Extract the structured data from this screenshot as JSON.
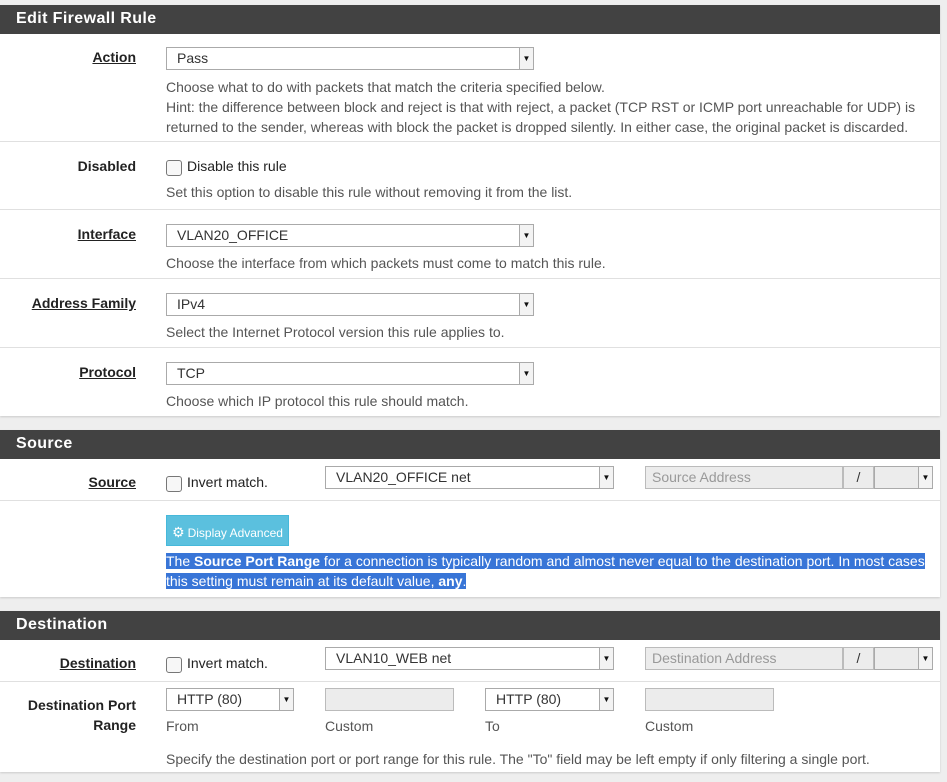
{
  "rule_panel": {
    "title": "Edit Firewall Rule",
    "action": {
      "label": "Action",
      "value": "Pass",
      "help_line1": "Choose what to do with packets that match the criteria specified below.",
      "help_line2": "Hint: the difference between block and reject is that with reject, a packet (TCP RST or ICMP port unreachable for UDP) is",
      "help_line3": "returned to the sender, whereas with block the packet is dropped silently. In either case, the original packet is discarded."
    },
    "disabled": {
      "label": "Disabled",
      "checkbox_text": "Disable this rule",
      "help": "Set this option to disable this rule without removing it from the list."
    },
    "interface": {
      "label": "Interface",
      "value": "VLAN20_OFFICE",
      "help": "Choose the interface from which packets must come to match this rule."
    },
    "address_family": {
      "label": "Address Family",
      "value": "IPv4",
      "help": "Select the Internet Protocol version this rule applies to."
    },
    "protocol": {
      "label": "Protocol",
      "value": "TCP",
      "help": "Choose which IP protocol this rule should match."
    }
  },
  "source_panel": {
    "title": "Source",
    "label": "Source",
    "invert_text": "Invert match.",
    "type_value": "VLAN20_OFFICE net",
    "address_placeholder": "Source Address",
    "slash": "/",
    "advanced_button": "Display Advanced",
    "help_1": "The ",
    "help_bold1": "Source Port Range",
    "help_2": " for a connection is typically random and almost never equal to the destination port. In most cases",
    "help_3": "this setting must remain at its default value, ",
    "help_bold2": "any",
    "help_4": "."
  },
  "destination_panel": {
    "title": "Destination",
    "label": "Destination",
    "invert_text": "Invert match.",
    "type_value": "VLAN10_WEB net",
    "address_placeholder": "Destination Address",
    "slash": "/",
    "port_range_label_1": "Destination Port",
    "port_range_label_2": "Range",
    "from_value": "HTTP (80)",
    "from_label": "From",
    "custom_label_1": "Custom",
    "to_value": "HTTP (80)",
    "to_label": "To",
    "custom_label_2": "Custom",
    "help": "Specify the destination port or port range for this rule. The \"To\" field may be left empty if only filtering a single port."
  },
  "icons": {
    "dropdown": "dropdown-arrow-icon",
    "gear": "gear-icon"
  },
  "colors": {
    "header": "#424242",
    "info_button": "#5bc0de",
    "selection": "#3875d7"
  }
}
